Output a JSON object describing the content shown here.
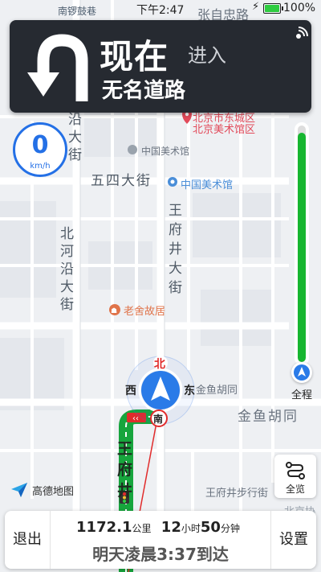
{
  "status_bar": {
    "time": "下午2:47",
    "battery_percent": "100%",
    "battery_level": 1.0
  },
  "map": {
    "labels": [
      {
        "id": "nanluoguxiang",
        "text": "南锣鼓巷"
      },
      {
        "id": "zhangzizhonglu",
        "text": "张自忠路"
      },
      {
        "id": "meishuguan_district",
        "text": "北京市东城区"
      },
      {
        "id": "meishuguan_district_2",
        "text": "北京美术馆区"
      },
      {
        "id": "meishuguan_1",
        "text": "中国美术馆"
      },
      {
        "id": "meishuguan_2",
        "text": "中国美术馆"
      },
      {
        "id": "wusi_st",
        "text": "五四大街"
      },
      {
        "id": "beiheyan_top",
        "text": "沿大街"
      },
      {
        "id": "beiheyan",
        "text": "北河沿大街"
      },
      {
        "id": "wangfujing",
        "text": "王府井大街"
      },
      {
        "id": "laoshe",
        "text": "老舍故居"
      },
      {
        "id": "jinyu_small",
        "text": "金鱼胡同"
      },
      {
        "id": "jinyu_big",
        "text": "金鱼胡同"
      },
      {
        "id": "wangfujing_ped",
        "text": "王府井步行街"
      },
      {
        "id": "route_road",
        "text": "王府井"
      },
      {
        "id": "beijing_right",
        "text": "北京协"
      }
    ],
    "compass": {
      "north": "北",
      "south": "南",
      "west": "西",
      "east": "东"
    }
  },
  "guidance": {
    "distance": "现在",
    "action": "进入",
    "road_name": "无名道路",
    "maneuver_icon": "u-turn-left-icon"
  },
  "speed": {
    "value": "0",
    "unit": "km/h"
  },
  "progress": {
    "label": "全程",
    "completed_fraction": 0.97
  },
  "overview_button": {
    "label": "全览"
  },
  "logo": {
    "text": "高德地图"
  },
  "bottom_bar": {
    "exit_label": "退出",
    "settings_label": "设置",
    "distance_value": "1172.1",
    "distance_unit": "公里",
    "hours": "12",
    "hours_unit": "小时",
    "minutes": "50",
    "minutes_unit": "分钟",
    "eta": "明天凌晨3:37到达"
  },
  "colors": {
    "card_bg": "#262a31",
    "accent_blue": "#2470e6",
    "progress_green": "#17b630",
    "route_green": "#17a53d"
  }
}
